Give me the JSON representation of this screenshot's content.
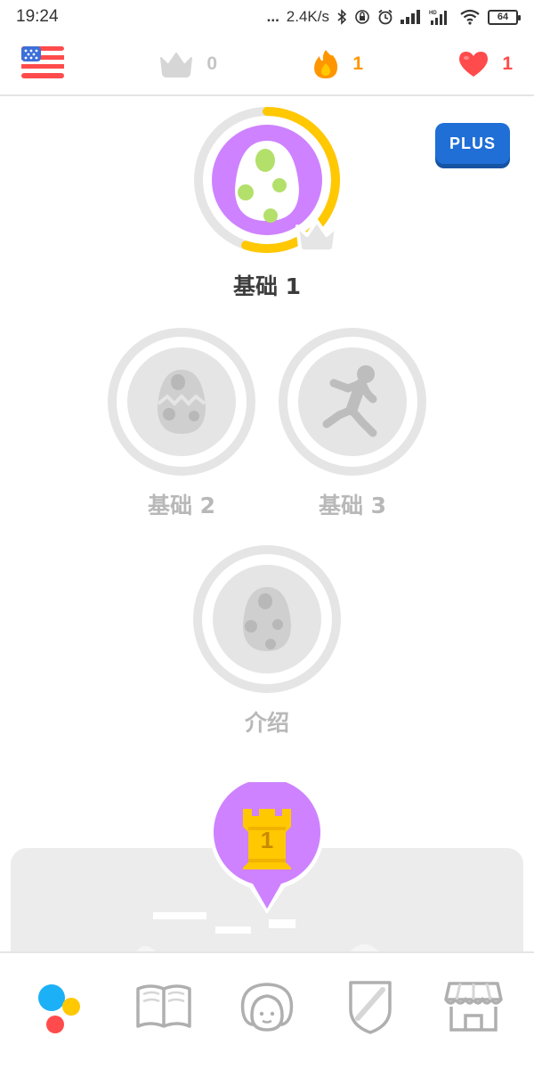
{
  "status_bar": {
    "time": "19:24",
    "dots": "...",
    "speed": "2.4K/s",
    "battery": "64"
  },
  "top_bar": {
    "language": "us-flag-icon",
    "crowns": "0",
    "streak": "1",
    "hearts": "1"
  },
  "plus_button": {
    "label": "PLUS"
  },
  "skills": [
    {
      "label": "基础 1",
      "state": "active",
      "progress": 0.55,
      "icon": "egg-icon",
      "color": "#ce82ff"
    },
    {
      "label": "基础 2",
      "state": "locked",
      "icon": "cracked-egg-icon"
    },
    {
      "label": "基础 3",
      "state": "locked",
      "icon": "running-person-icon"
    },
    {
      "label": "介绍",
      "state": "locked",
      "icon": "egg-icon"
    }
  ],
  "checkpoint": {
    "label": "1",
    "icon": "castle-icon"
  },
  "bottom_nav": [
    {
      "id": "learn",
      "icon": "dots-learn-icon",
      "active": true
    },
    {
      "id": "stories",
      "icon": "book-icon",
      "active": false
    },
    {
      "id": "profile",
      "icon": "profile-face-icon",
      "active": false
    },
    {
      "id": "leagues",
      "icon": "shield-icon",
      "active": false
    },
    {
      "id": "shop",
      "icon": "shop-icon",
      "active": false
    }
  ],
  "colors": {
    "accent_purple": "#ce82ff",
    "gold": "#ffc800",
    "plus_blue": "#1f6fd6",
    "streak_orange": "#ff9600",
    "heart_red": "#ff4b4b",
    "locked_gray": "#e5e5e5"
  }
}
